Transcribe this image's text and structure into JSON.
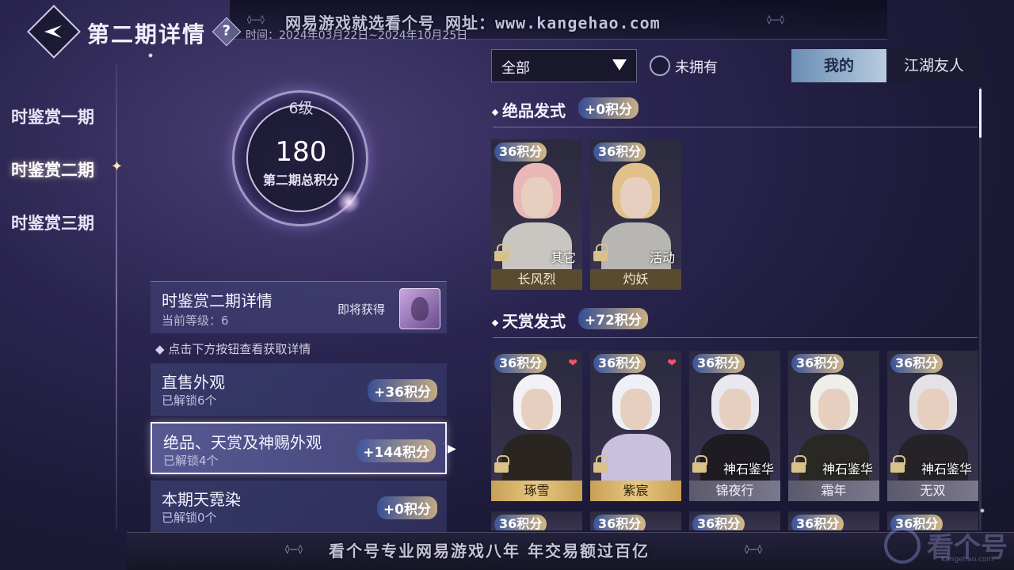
{
  "header": {
    "title": "第二期详情",
    "time_text": "时间：2024年03月22日~2024年10月25日"
  },
  "watermarks": {
    "top": "网易游戏就选看个号  网址：www.kangehao.com",
    "bottom": "看个号专业网易游戏八年  年交易额过百亿",
    "logo": "看个号",
    "logo_sub": "kangehao.com"
  },
  "sidebar": {
    "items": [
      {
        "label": "时鉴赏一期"
      },
      {
        "label": "时鉴赏二期"
      },
      {
        "label": "时鉴赏三期"
      }
    ],
    "active_index": 1
  },
  "ring": {
    "level": "6级",
    "score": "180",
    "label": "第二期总积分"
  },
  "detail": {
    "title": "时鉴赏二期详情",
    "level_text": "当前等级：6",
    "soon_label": "即将获得"
  },
  "hint": "点击下方按钮查看获取详情",
  "categories": [
    {
      "name": "直售外观",
      "sub": "已解锁6个",
      "pts": "+36积分"
    },
    {
      "name": "绝品、天赏及神赐外观",
      "sub": "已解锁4个",
      "pts": "+144积分"
    },
    {
      "name": "本期天霓染",
      "sub": "已解锁0个",
      "pts": "+0积分"
    }
  ],
  "filter": {
    "selected": "全部",
    "unowned_label": "未拥有",
    "unowned_checked": false
  },
  "tabs": {
    "mine": "我的",
    "friends": "江湖友人",
    "active": "mine"
  },
  "sections": [
    {
      "title": "绝品发式",
      "pts": "+0积分",
      "cards": [
        {
          "pts": "36积分",
          "source": "其它",
          "name": "长风烈",
          "hair_color": "#e9b7b6",
          "body_color": "#c9c6c2",
          "bar": "dark",
          "heart": false
        },
        {
          "pts": "36积分",
          "source": "活动",
          "name": "灼妖",
          "hair_color": "#e1c08a",
          "body_color": "#b8b6b2",
          "bar": "dark",
          "heart": false
        }
      ]
    },
    {
      "title": "天赏发式",
      "pts": "+72积分",
      "cards": [
        {
          "pts": "36积分",
          "source": "",
          "name": "琢雪",
          "hair_color": "#f2f2f6",
          "body_color": "#2a2520",
          "bar": "gold",
          "heart": true
        },
        {
          "pts": "36积分",
          "source": "",
          "name": "紫宸",
          "hair_color": "#eef0f8",
          "body_color": "#c8c0dc",
          "bar": "gold",
          "heart": true
        },
        {
          "pts": "36积分",
          "source": "神石鉴华",
          "name": "锦夜行",
          "hair_color": "#e8e8ee",
          "body_color": "#1e1c22",
          "bar": "grey",
          "heart": false
        },
        {
          "pts": "36积分",
          "source": "神石鉴华",
          "name": "霜年",
          "hair_color": "#f0eee8",
          "body_color": "#2a2824",
          "bar": "grey",
          "heart": false
        },
        {
          "pts": "36积分",
          "source": "神石鉴华",
          "name": "无双",
          "hair_color": "#e4e2e6",
          "body_color": "#252327",
          "bar": "grey",
          "heart": false
        }
      ]
    }
  ],
  "next_row": {
    "pts_tags": [
      "36积分",
      "36积分",
      "36积分",
      "36积分",
      "36积分"
    ]
  }
}
